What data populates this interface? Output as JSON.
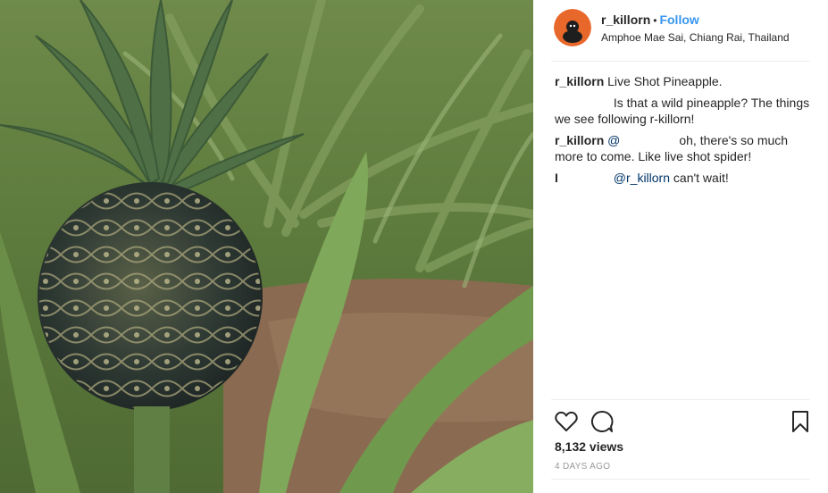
{
  "post": {
    "username": "r_killorn",
    "separator": "•",
    "follow_label": "Follow",
    "location": "Amphoe Mae Sai, Chiang Rai, Thailand"
  },
  "comments": [
    {
      "user": "r_killorn",
      "text": "Live Shot Pineapple."
    },
    {
      "user": "",
      "text": "Is that a wild pineapple? The things we see following r-killorn!"
    },
    {
      "user": "r_killorn",
      "mention": "@",
      "text_after": "oh, there's so much more to come. Like live shot spider!"
    },
    {
      "user": "I",
      "mention": "@r_killorn",
      "text_after": "can't wait!"
    }
  ],
  "actions": {
    "like_icon": "heart-icon",
    "comment_icon": "speech-bubble-icon",
    "save_icon": "bookmark-icon"
  },
  "stats": {
    "views": "8,132 views",
    "posted": "4 DAYS AGO"
  },
  "colors": {
    "accent": "#3897f0",
    "mention": "#003569",
    "muted": "#999999",
    "avatar_bg": "#e8672a"
  }
}
